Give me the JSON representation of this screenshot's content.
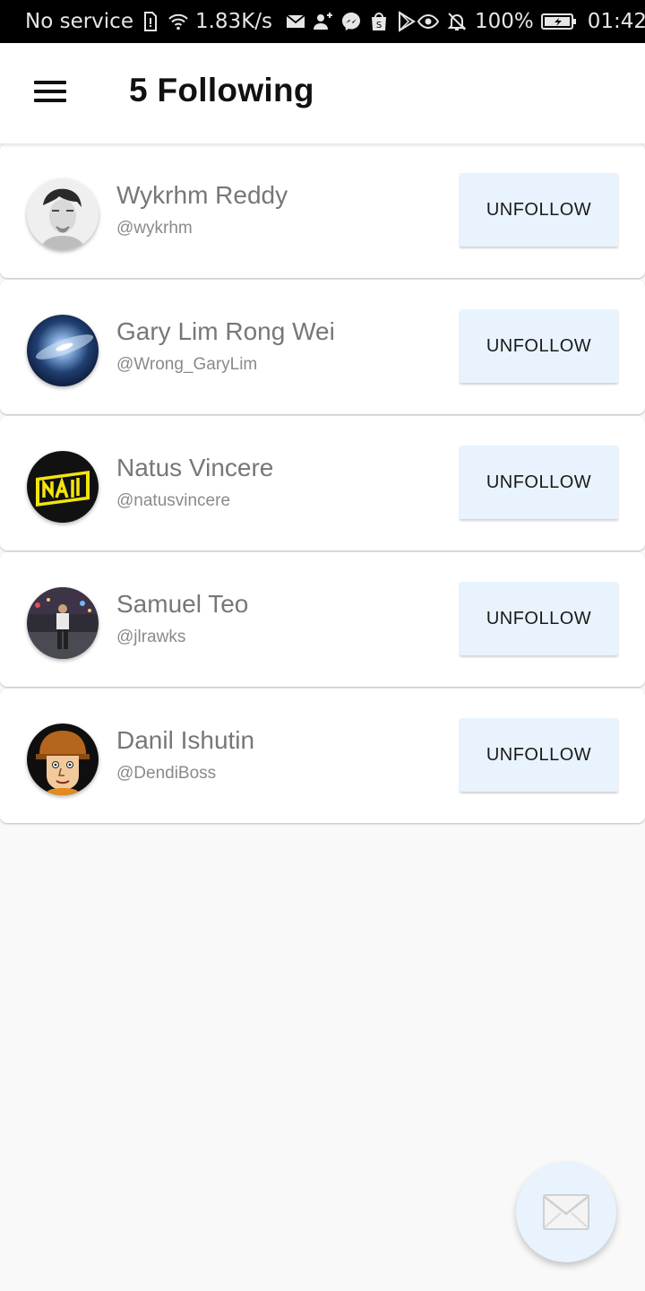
{
  "status_bar": {
    "carrier": "No service",
    "speed": "1.83K/s",
    "battery": "100%",
    "time": "01:42",
    "icons": [
      "sim-alert-icon",
      "wifi-icon",
      "mail-icon",
      "add-contact-icon",
      "messenger-icon",
      "shop-icon",
      "play-store-icon",
      "eye-icon",
      "bell-off-icon",
      "battery-icon"
    ]
  },
  "header": {
    "title": "5 Following",
    "menu_icon": "hamburger-menu-icon"
  },
  "following": [
    {
      "name": "Wykrhm Reddy",
      "handle": "@wykrhm",
      "button": "UNFOLLOW"
    },
    {
      "name": "Gary Lim Rong Wei",
      "handle": "@Wrong_GaryLim",
      "button": "UNFOLLOW"
    },
    {
      "name": "Natus Vincere",
      "handle": "@natusvincere",
      "button": "UNFOLLOW"
    },
    {
      "name": "Samuel Teo",
      "handle": "@jlrawks",
      "button": "UNFOLLOW"
    },
    {
      "name": "Danil Ishutin",
      "handle": "@DendiBoss",
      "button": "UNFOLLOW"
    }
  ],
  "fab": {
    "icon": "envelope-icon"
  },
  "colors": {
    "button_bg": "#e8f3fd",
    "page_bg": "#f9f9f9",
    "status_bar_bg": "#000000"
  }
}
